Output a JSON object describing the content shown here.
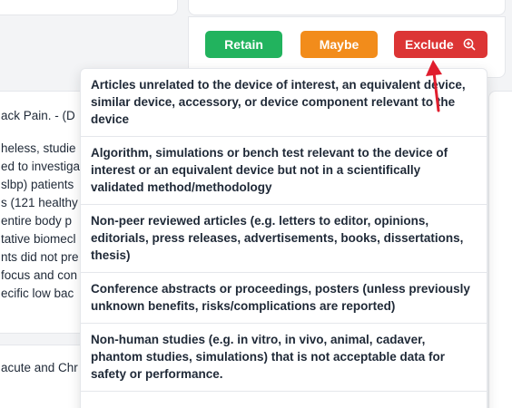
{
  "background_text": {
    "line_0": "ack Pain. - (D",
    "lines": [
      "heless, studie",
      "ed to investiga",
      "slbp) patients",
      "s (121 healthy",
      "entire body p",
      "tative biomecl",
      "nts did not pre",
      "focus and con",
      "ecific low bac"
    ],
    "bottom_line": "acute and Chr"
  },
  "actions": {
    "retain_label": "Retain",
    "maybe_label": "Maybe",
    "exclude_label": "Exclude"
  },
  "dropdown": {
    "items": [
      "Articles unrelated to the device of interest, an equivalent device, similar device, accessory, or device component relevant to the device",
      "Algorithm, simulations or bench test relevant to the device of interest or an equivalent device but not in a scientifically validated method/methodology",
      "Non-peer reviewed articles (e.g. letters to editor, opinions, editorials, press releases, advertisements, books, dissertations, thesis)",
      "Conference abstracts or proceedings, posters (unless previously unknown benefits, risks/complications are reported)",
      "Non-human studies (e.g. in vitro, in vivo, animal, cadaver, phantom studies, simulations) that is not acceptable data for safety or performance."
    ]
  },
  "colors": {
    "retain": "#22b35e",
    "maybe": "#f28c1b",
    "exclude": "#dc3535",
    "annotation_arrow": "#e01e2e"
  },
  "icons": {
    "exclude_icon": "search-plus-icon",
    "annotation": "red-arrow-annotation"
  }
}
